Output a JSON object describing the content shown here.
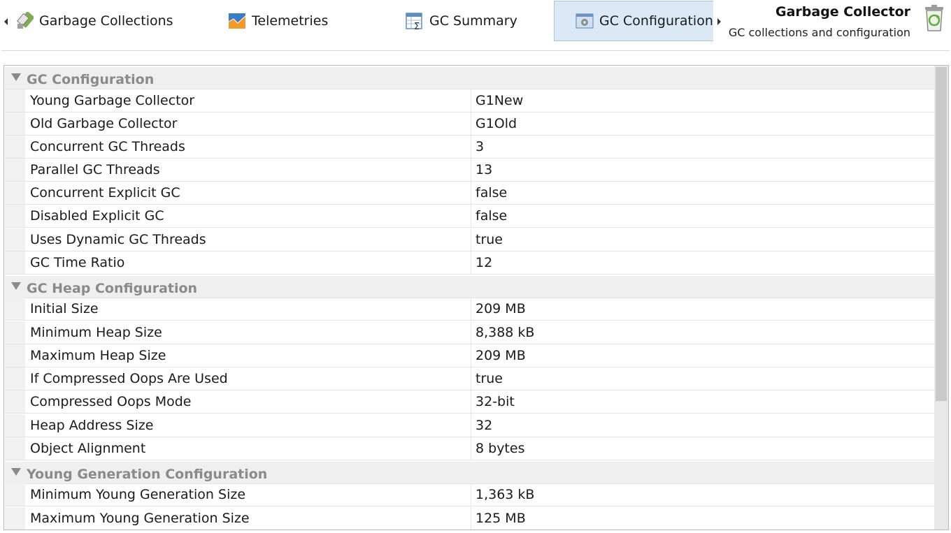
{
  "tabs": [
    {
      "label": "Garbage Collections",
      "icon": "gc-icon"
    },
    {
      "label": "Telemetries",
      "icon": "telemetries-icon"
    },
    {
      "label": "GC Summary",
      "icon": "summary-icon"
    },
    {
      "label": "GC Configuration",
      "icon": "config-icon",
      "selected": true
    }
  ],
  "header": {
    "title": "Garbage Collector",
    "subtitle": "GC collections and configuration",
    "icon": "recycle-bin-icon"
  },
  "groups": [
    {
      "label": "GC Configuration",
      "rows": [
        {
          "key": "Young Garbage Collector",
          "value": "G1New"
        },
        {
          "key": "Old Garbage Collector",
          "value": "G1Old"
        },
        {
          "key": "Concurrent GC Threads",
          "value": "3"
        },
        {
          "key": "Parallel GC Threads",
          "value": "13"
        },
        {
          "key": "Concurrent Explicit GC",
          "value": "false"
        },
        {
          "key": "Disabled Explicit GC",
          "value": "false"
        },
        {
          "key": "Uses Dynamic GC Threads",
          "value": "true"
        },
        {
          "key": "GC Time Ratio",
          "value": "12"
        }
      ]
    },
    {
      "label": "GC Heap Configuration",
      "rows": [
        {
          "key": "Initial Size",
          "value": "209 MB"
        },
        {
          "key": "Minimum Heap Size",
          "value": "8,388 kB"
        },
        {
          "key": "Maximum Heap Size",
          "value": "209 MB"
        },
        {
          "key": "If Compressed Oops Are Used",
          "value": "true"
        },
        {
          "key": "Compressed Oops Mode",
          "value": "32-bit"
        },
        {
          "key": "Heap Address Size",
          "value": "32"
        },
        {
          "key": "Object Alignment",
          "value": "8 bytes"
        }
      ]
    },
    {
      "label": "Young Generation Configuration",
      "rows": [
        {
          "key": "Minimum Young Generation Size",
          "value": "1,363 kB"
        },
        {
          "key": "Maximum Young Generation Size",
          "value": "125 MB"
        }
      ]
    }
  ]
}
